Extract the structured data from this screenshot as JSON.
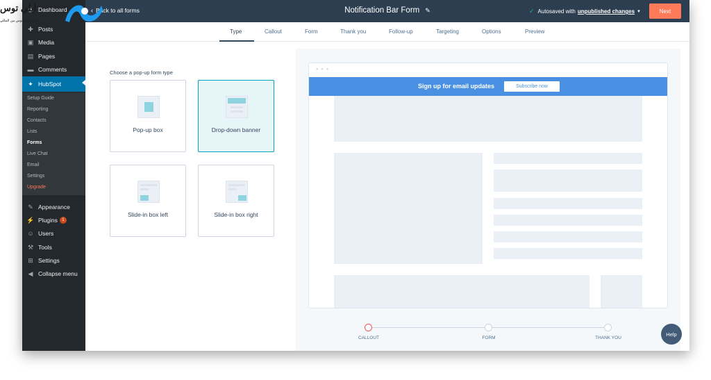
{
  "logo": {
    "text": "ايلي توس",
    "subtitle": "شركة ايلي توس بين المللي"
  },
  "sidebar": {
    "items": [
      {
        "label": "Dashboard",
        "icon": "dashboard-icon",
        "glyph": "◉"
      },
      {
        "label": "Posts",
        "icon": "pin-icon",
        "glyph": "📌"
      },
      {
        "label": "Media",
        "icon": "media-icon",
        "glyph": "▣"
      },
      {
        "label": "Pages",
        "icon": "pages-icon",
        "glyph": "▤"
      },
      {
        "label": "Comments",
        "icon": "comments-icon",
        "glyph": "▬"
      },
      {
        "label": "HubSpot",
        "icon": "hubspot-icon",
        "glyph": "⚙"
      }
    ],
    "submenu": [
      "Setup Guide",
      "Reporting",
      "Contacts",
      "Lists",
      "Forms",
      "Live Chat",
      "Email",
      "Settings",
      "Upgrade"
    ],
    "lower": [
      {
        "label": "Appearance",
        "icon": "brush-icon",
        "glyph": "✎"
      },
      {
        "label": "Plugins",
        "icon": "plugin-icon",
        "glyph": "⚡",
        "badge": "1"
      },
      {
        "label": "Users",
        "icon": "user-icon",
        "glyph": "👤"
      },
      {
        "label": "Tools",
        "icon": "wrench-icon",
        "glyph": "🔧"
      },
      {
        "label": "Settings",
        "icon": "settings-icon",
        "glyph": "⊞"
      },
      {
        "label": "Collapse menu",
        "icon": "collapse-icon",
        "glyph": "◀"
      }
    ]
  },
  "topbar": {
    "back": "Back to all forms",
    "title": "Notification Bar Form",
    "autosave_prefix": "Autosaved with",
    "autosave_link": "unpublished changes",
    "next": "Next"
  },
  "tabs": [
    "Type",
    "Callout",
    "Form",
    "Thank you",
    "Follow-up",
    "Targeting",
    "Options",
    "Preview"
  ],
  "chooser": {
    "label": "Choose a pop-up form type",
    "types": [
      "Pop-up box",
      "Drop-down banner",
      "Slide-in box left",
      "Slide-in box right"
    ],
    "selected": "Drop-down banner"
  },
  "preview": {
    "banner_text": "Sign up for email updates",
    "banner_button": "Subscribe now",
    "accent": "#4a90e2"
  },
  "progress": {
    "steps": [
      "CALLOUT",
      "FORM",
      "THANK YOU"
    ],
    "current": "CALLOUT"
  },
  "help": "Help",
  "colors": {
    "topbar": "#2d3e50",
    "next": "#ff7a59",
    "wp_active": "#0073aa",
    "selected_card": "#e5f5f8"
  }
}
